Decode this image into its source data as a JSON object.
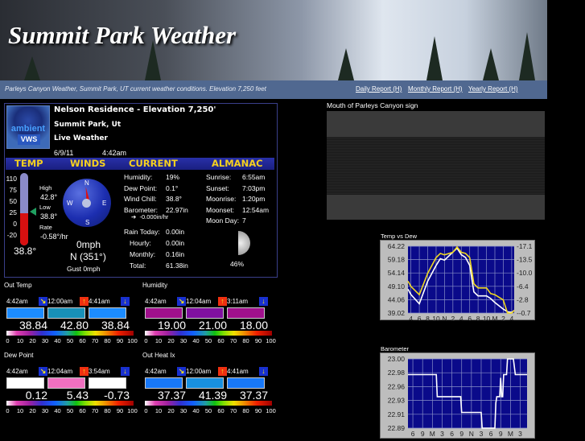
{
  "header": {
    "title": "Summit Park Weather",
    "subtitle": "Parleys Canyon Weather, Summit Park, UT current weather conditions. Elevation 7,250 feet",
    "links": [
      {
        "label": "Daily Report",
        "hotkey": "(H)"
      },
      {
        "label": "Monthly Report",
        "hotkey": "(H)"
      },
      {
        "label": "Yearly Report",
        "hotkey": "(H)"
      }
    ]
  },
  "station": {
    "logo_text": "ambient",
    "logo_badge": "VWS",
    "name": "Nelson Residence - Elevation 7,250'",
    "location": "Summit Park, Ut",
    "status": "Live Weather",
    "date": "6/9/11",
    "time": "4:42am"
  },
  "sections": [
    "TEMP",
    "WINDS",
    "CURRENT",
    "ALMANAC"
  ],
  "temp": {
    "scale": [
      "110",
      "75",
      "50",
      "25",
      "0",
      "-20"
    ],
    "high_label": "High",
    "high": "42.8°",
    "low_label": "Low",
    "low": "38.8°",
    "rate_label": "Rate",
    "rate": "-0.58°/hr",
    "current": "38.8°",
    "fill_fraction": 0.45
  },
  "wind": {
    "dirs": [
      "N",
      "E",
      "S",
      "W"
    ],
    "speed": "0mph",
    "direction": "N (351°)",
    "gust_label": "Gust",
    "gust": "0mph"
  },
  "current": [
    {
      "label": "Humidity:",
      "value": "19%"
    },
    {
      "label": "Dew Point:",
      "value": "0.1°"
    },
    {
      "label": "Wind Chill:",
      "value": "38.8°"
    },
    {
      "label": "Barometer:",
      "value": "22.97in"
    }
  ],
  "baro_trend": "-0.000in/hr",
  "rain": [
    {
      "label": "Rain Today:",
      "value": "0.00in"
    },
    {
      "label": "Hourly:",
      "value": "0.00in"
    },
    {
      "label": "Monthly:",
      "value": "0.16in"
    },
    {
      "label": "Total:",
      "value": "61.38in"
    }
  ],
  "almanac": [
    {
      "label": "Sunrise:",
      "value": "6:55am"
    },
    {
      "label": "Sunset:",
      "value": "7:03pm"
    },
    {
      "label": "Moonrise:",
      "value": "1:20pm"
    },
    {
      "label": "Moonset:",
      "value": "12:54am"
    },
    {
      "label": "Moon Day:",
      "value": "7"
    }
  ],
  "moon_pct": "46%",
  "gauges": [
    {
      "title": "Out Temp",
      "cols": [
        {
          "time": "4:42am",
          "icon": "current",
          "value": "38.84",
          "color": "#1c8cff"
        },
        {
          "time": "12:00am",
          "icon": "high",
          "value": "42.80",
          "color": "#1890b8"
        },
        {
          "time": "4:41am",
          "icon": "low",
          "value": "38.84",
          "color": "#1c8cff"
        }
      ]
    },
    {
      "title": "Humidity",
      "cols": [
        {
          "time": "4:42am",
          "icon": "current",
          "value": "19.00",
          "color": "#a0108c"
        },
        {
          "time": "12:04am",
          "icon": "high",
          "value": "21.00",
          "color": "#8010a0"
        },
        {
          "time": "3:11am",
          "icon": "low",
          "value": "18.00",
          "color": "#a0108c"
        }
      ]
    },
    {
      "title": "Dew Point",
      "cols": [
        {
          "time": "4:42am",
          "icon": "current",
          "value": "0.12",
          "color": "#ffffff"
        },
        {
          "time": "12:04am",
          "icon": "high",
          "value": "5.43",
          "color": "#f070c0"
        },
        {
          "time": "3:54am",
          "icon": "low",
          "value": "-0.73",
          "color": "#ffffff"
        }
      ]
    },
    {
      "title": "Out Heat Ix",
      "cols": [
        {
          "time": "4:42am",
          "icon": "current",
          "value": "37.37",
          "color": "#1878f8"
        },
        {
          "time": "12:00am",
          "icon": "high",
          "value": "41.39",
          "color": "#1890e0"
        },
        {
          "time": "4:41am",
          "icon": "low",
          "value": "37.37",
          "color": "#1878f8"
        }
      ]
    }
  ],
  "scale_labels": [
    "0",
    "10",
    "20",
    "30",
    "40",
    "50",
    "60",
    "70",
    "80",
    "90",
    "100"
  ],
  "camera": {
    "title": "Mouth of Parleys Canyon sign"
  },
  "chart_data": [
    {
      "type": "line",
      "title": "Temp vs Dew",
      "categories": [
        "4",
        "6",
        "8",
        "10",
        "N",
        "2",
        "4",
        "6",
        "8",
        "10",
        "M",
        "2",
        "4"
      ],
      "x_ticks_hours": [
        4,
        6,
        8,
        10,
        12,
        14,
        16,
        18,
        20,
        22,
        24,
        26,
        28
      ],
      "xlim": [
        3.3,
        28.6
      ],
      "left_ticks": [
        "64.22",
        "59.18",
        "54.14",
        "49.10",
        "44.06",
        "39.02"
      ],
      "ylim": [
        39.02,
        64.22
      ],
      "right_ticks": [
        "17.1",
        "13.5",
        "10.0",
        "6.4",
        "2.8",
        "-0.7"
      ],
      "y2lim": [
        -0.7,
        17.1
      ],
      "series": [
        {
          "name": "Temp",
          "axis": "left",
          "color": "#ffffff",
          "x": [
            3.3,
            4,
            6,
            8,
            10,
            11,
            12,
            14,
            15,
            16,
            17,
            18,
            19,
            20,
            22,
            23,
            24,
            26,
            27,
            28,
            28.6
          ],
          "values": [
            48,
            46,
            42.5,
            51,
            57,
            59.5,
            59,
            62,
            63.5,
            61,
            60,
            57,
            47,
            45.5,
            45.5,
            44.5,
            43,
            40.5,
            39.5,
            39.3,
            40
          ]
        },
        {
          "name": "Dew",
          "axis": "right",
          "color": "#f0d820",
          "x": [
            3.3,
            4,
            6,
            8,
            10,
            11,
            12,
            14,
            15,
            16,
            17,
            18,
            19,
            20,
            22,
            23,
            24,
            26,
            27,
            28,
            28.6
          ],
          "values": [
            7.8,
            6.4,
            4.2,
            9.9,
            14.1,
            15.2,
            14.8,
            15.5,
            16.9,
            15.5,
            15.2,
            14.1,
            7.1,
            6.0,
            6.0,
            4.5,
            4.2,
            2.8,
            -0.7,
            -0.7,
            0.0
          ]
        }
      ]
    },
    {
      "type": "line",
      "title": "Barometer",
      "categories": [
        "6",
        "9",
        "M",
        "3",
        "6",
        "9",
        "N",
        "3",
        "6",
        "9",
        "M",
        "3"
      ],
      "xlim": [
        -0.5,
        11.7
      ],
      "left_ticks": [
        "23.00",
        "22.98",
        "22.96",
        "22.93",
        "22.91",
        "22.89"
      ],
      "ylim": [
        22.89,
        23.0
      ],
      "series": [
        {
          "name": "Barometer",
          "color": "#ffffff",
          "x": [
            -0.5,
            2.4,
            2.5,
            4.9,
            5.0,
            7.0,
            7.1,
            8.0,
            8.1,
            8.4,
            8.5,
            8.6,
            8.9,
            9.0,
            9.1,
            9.2,
            9.3,
            9.4,
            9.6,
            9.7,
            10.3,
            10.5,
            11.7
          ],
          "values": [
            22.975,
            22.975,
            22.94,
            22.94,
            22.915,
            22.915,
            22.89,
            22.89,
            22.89,
            22.89,
            22.93,
            22.94,
            22.94,
            22.97,
            22.94,
            22.94,
            22.975,
            22.975,
            22.975,
            23.0,
            23.0,
            22.975,
            22.975
          ]
        }
      ]
    }
  ]
}
